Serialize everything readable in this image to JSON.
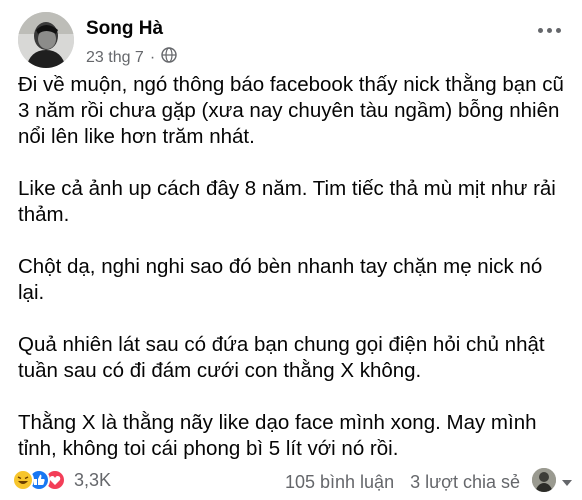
{
  "post": {
    "author": "Song Hà",
    "timestamp": "23 thg 7",
    "separator": "·",
    "audience_icon": "globe-icon",
    "paragraphs": [
      "Đi về muộn, ngó thông báo facebook thấy nick thằng bạn cũ 3 năm rồi chưa gặp (xưa nay chuyên tàu ngầm) bỗng nhiên nổi lên like hơn trăm nhát.",
      "Like cả ảnh up cách đây 8 năm. Tim tiếc thả mù mịt như rải thảm.",
      "Chột dạ, nghi nghi sao đó bèn nhanh tay chặn mẹ nick nó lại.",
      "Quả nhiên lát sau có đứa bạn chung gọi điện hỏi chủ nhật tuần sau có đi đám cưới con thằng X không.",
      "Thằng X là thằng nãy like dạo face mình xong. May mình tỉnh, không toi cái phong bì 5 lít với nó rồi."
    ]
  },
  "footer": {
    "reaction_icons": [
      "haha-icon",
      "like-icon",
      "love-icon"
    ],
    "reaction_count": "3,3K",
    "comments": "105 bình luận",
    "shares": "3 lượt chia sẻ"
  },
  "colors": {
    "text": "#050505",
    "secondary": "#65676b",
    "like_blue": "#1877f2",
    "love_red": "#f33e58",
    "haha_yellow": "#f7c52c"
  }
}
